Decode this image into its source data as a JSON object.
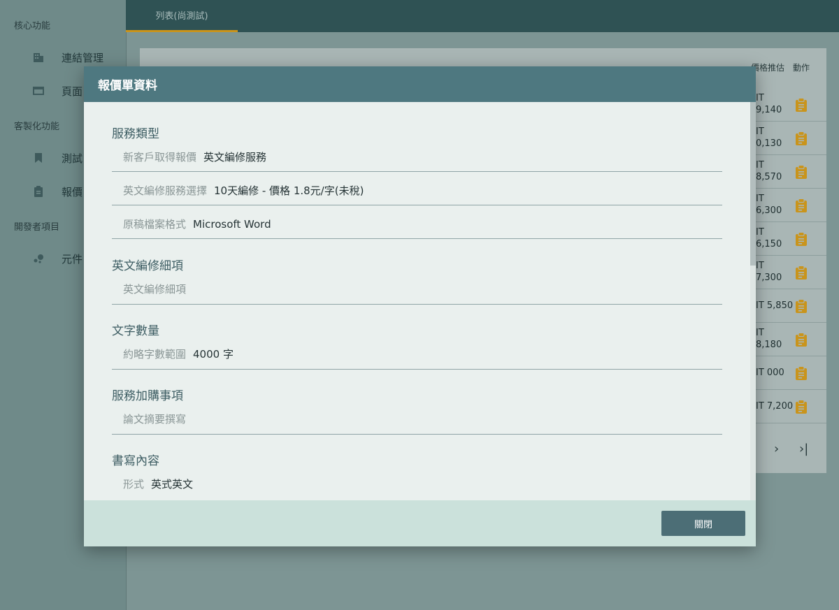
{
  "sidebar": {
    "sections": [
      {
        "title": "核心功能",
        "items": [
          {
            "label": "連結管理",
            "icon": "building-icon"
          },
          {
            "label": "頁面",
            "icon": "window-icon"
          }
        ]
      },
      {
        "title": "客製化功能",
        "items": [
          {
            "label": "測試",
            "icon": "bookmark-icon"
          },
          {
            "label": "報價",
            "icon": "clipboard-icon"
          }
        ]
      },
      {
        "title": "開發者項目",
        "items": [
          {
            "label": "元件",
            "icon": "bubbles-icon"
          }
        ]
      }
    ]
  },
  "topbar": {
    "tab_label": "列表(尚測試)"
  },
  "table": {
    "headers": {
      "price_estimate": "價格推估",
      "action": "動作"
    },
    "rows": [
      {
        "price": "IT\n9,140"
      },
      {
        "price": "IT\n0,130"
      },
      {
        "price": "IT\n8,570"
      },
      {
        "price": "IT\n6,300"
      },
      {
        "price": "IT\n6,150"
      },
      {
        "price": "IT\n7,300"
      },
      {
        "price": "IT 5,850"
      },
      {
        "price": "IT\n8,180"
      },
      {
        "price": "IT 000"
      },
      {
        "price": "IT 7,200"
      }
    ],
    "pager": {
      "next": "›",
      "last": "›|"
    }
  },
  "modal": {
    "title": "報價單資料",
    "sections": [
      {
        "title": "服務類型",
        "fields": [
          {
            "label": "新客戶取得報價",
            "value": "英文編修服務"
          },
          {
            "label": "英文編修服務選擇",
            "value": "10天編修 - 價格 1.8元/字(未稅)"
          },
          {
            "label": "原稿檔案格式",
            "value": "Microsoft Word"
          }
        ]
      },
      {
        "title": "英文編修細項",
        "fields": [
          {
            "label": "英文編修細項",
            "value": ""
          }
        ]
      },
      {
        "title": "文字數量",
        "fields": [
          {
            "label": "約略字數範圍",
            "value": "4000 字"
          }
        ]
      },
      {
        "title": "服務加購事項",
        "fields": [
          {
            "label": "論文摘要撰寫",
            "value": ""
          }
        ]
      },
      {
        "title": "書寫內容",
        "fields": [
          {
            "label": "形式",
            "value": "英式英文"
          }
        ]
      }
    ],
    "close_label": "關閉"
  },
  "colors": {
    "modal_header": "#4e7880",
    "accent_gold": "#c9941c",
    "close_button": "#4c6e76",
    "footer": "#cbe1db"
  }
}
